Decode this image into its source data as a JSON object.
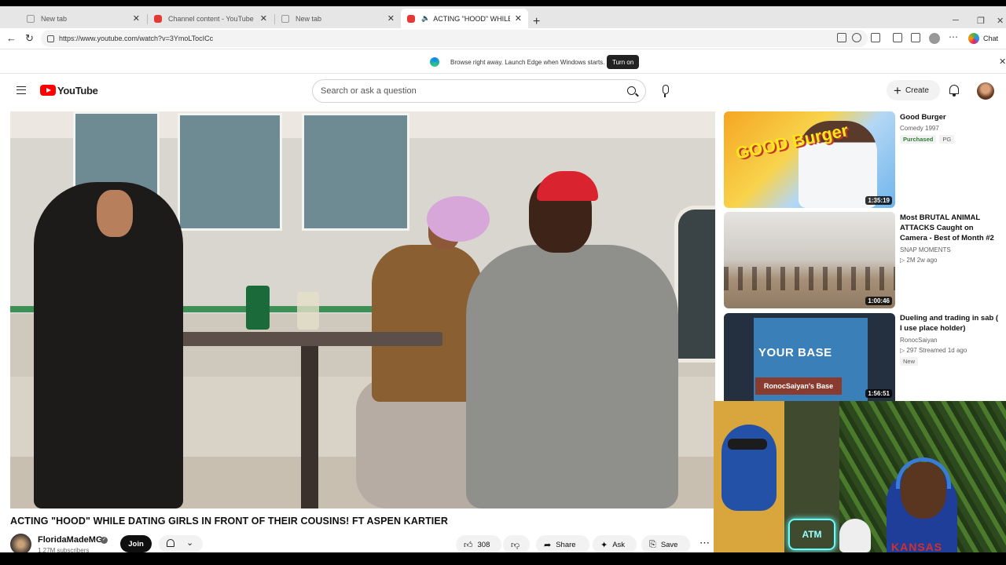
{
  "browser": {
    "tabs": [
      {
        "label": "New tab",
        "icon": "page-icon"
      },
      {
        "label": "Channel content - YouTube Studio",
        "icon": "youtube-studio-icon"
      },
      {
        "label": "New tab",
        "icon": "page-icon"
      },
      {
        "label": "ACTING \"HOOD\" WHILE DATIN",
        "icon": "youtube-icon",
        "active": true,
        "audio": true
      }
    ],
    "url": "https://www.youtube.com/watch?v=3YmoLTocICc",
    "chat_label": "Chat"
  },
  "banner": {
    "text": "Browse right away. Launch Edge when Windows starts.",
    "button_label": "Turn on"
  },
  "yt_header": {
    "logo_text": "YouTube",
    "search_placeholder": "Search or ask a question",
    "create_label": "Create"
  },
  "video": {
    "title": "ACTING \"HOOD\" WHILE DATING GIRLS IN FRONT OF THEIR COUSINS! FT ASPEN KARTIER",
    "channel": "FloridaMadeMG",
    "subscribers": "1.27M subscribers",
    "join_label": "Join",
    "like_count": "308",
    "share_label": "Share",
    "ask_label": "Ask",
    "save_label": "Save"
  },
  "recommended": [
    {
      "title": "Good Burger",
      "line1": "Comedy 1997",
      "badges": [
        "Purchased",
        "PG"
      ],
      "duration": "1:35:19",
      "thumb_text": "GOOD Burger"
    },
    {
      "title": "Most BRUTAL ANIMAL ATTACKS Caught on Camera - Best of Month #2",
      "channel": "SNAP MOMENTS",
      "meta": "▷ 2M  2w ago",
      "duration": "1:00:46"
    },
    {
      "title": "Dueling and trading in sab ( I use place holder)",
      "channel": "RonocSaiyan",
      "meta": "▷ 297  Streamed 1d ago",
      "badge": "New",
      "duration": "1:56:51",
      "thumb_text": "YOUR BASE",
      "thumb_sub": "RonocSaiyan's Base"
    }
  ],
  "webcam": {
    "neon_sign": "ATM",
    "shirt_text": "KANSAS"
  },
  "colors": {
    "yt_red": "#ff0000",
    "join_bg": "#0f0f0f",
    "purchased_green": "#2e7d32"
  }
}
